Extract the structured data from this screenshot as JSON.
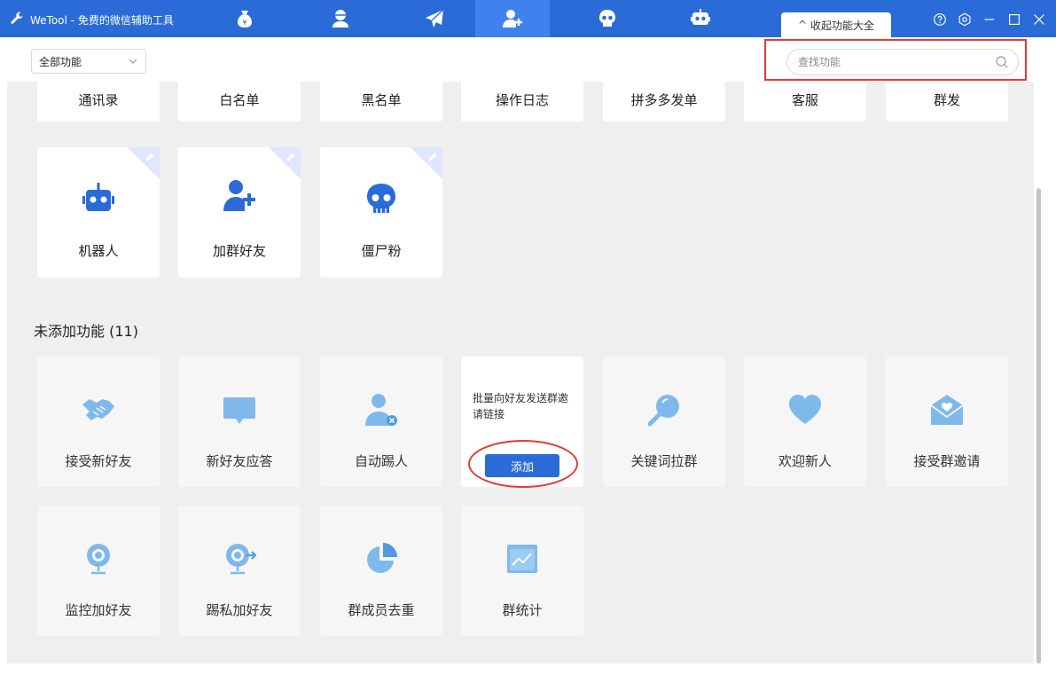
{
  "window": {
    "title": "WeTool - 免费的微信辅助工具",
    "collapse_tab_label": "收起功能大全",
    "accent_color": "#2a6bd8"
  },
  "nav_tabs": [
    {
      "icon": "money-bag-icon"
    },
    {
      "icon": "user-avatar-icon"
    },
    {
      "icon": "paper-plane-icon"
    },
    {
      "icon": "add-user-icon",
      "active": true
    },
    {
      "icon": "skull-icon"
    },
    {
      "icon": "robot-icon"
    }
  ],
  "window_controls": [
    {
      "icon": "help-icon"
    },
    {
      "icon": "settings-icon"
    },
    {
      "icon": "minimize-icon"
    },
    {
      "icon": "maximize-icon"
    },
    {
      "icon": "close-icon"
    }
  ],
  "toolbar": {
    "category_value": "全部功能",
    "search_placeholder": "查找功能"
  },
  "added": {
    "top_row": [
      "通讯录",
      "白名单",
      "黑名单",
      "操作日志",
      "拼多多发单",
      "客服",
      "群发"
    ],
    "cards": [
      {
        "label": "机器人",
        "icon": "robot-icon",
        "pinned": true
      },
      {
        "label": "加群好友",
        "icon": "add-user-icon",
        "pinned": true
      },
      {
        "label": "僵尸粉",
        "icon": "skull-icon",
        "pinned": true
      }
    ]
  },
  "not_added": {
    "title": "未添加功能 (11)",
    "cards": [
      {
        "label": "接受新好友",
        "icon": "handshake-icon"
      },
      {
        "label": "新好友应答",
        "icon": "chat-bubble-icon"
      },
      {
        "label": "自动踢人",
        "icon": "remove-user-icon"
      },
      {
        "hover_desc": "批量向好友发送群邀请链接",
        "button": "添加"
      },
      {
        "label": "关键词拉群",
        "icon": "magnifier-icon"
      },
      {
        "label": "欢迎新人",
        "icon": "heart-icon"
      },
      {
        "label": "接受群邀请",
        "icon": "envelope-heart-icon"
      },
      {
        "label": "监控加好友",
        "icon": "webcam-icon"
      },
      {
        "label": "踢私加好友",
        "icon": "webcam-arrow-icon"
      },
      {
        "label": "群成员去重",
        "icon": "pie-chart-icon"
      },
      {
        "label": "群统计",
        "icon": "line-chart-icon"
      }
    ]
  }
}
